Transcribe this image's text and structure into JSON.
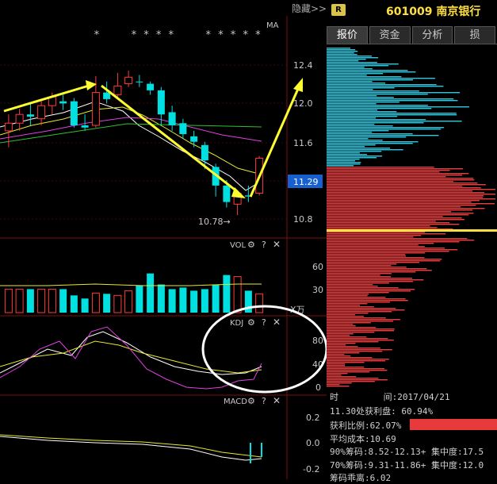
{
  "toolbar": {
    "hide_label": "隐藏>>"
  },
  "stock": {
    "badge": "R",
    "code_name": "601009 南京银行"
  },
  "tabs": [
    {
      "label": "报价"
    },
    {
      "label": "资金"
    },
    {
      "label": "分析"
    },
    {
      "label": "损"
    }
  ],
  "info": {
    "time_label": "时",
    "time_value": "间:2017/04/21",
    "profit_line": "11.30处获利盘: 60.94%",
    "profit_ratio": "获利比例:62.07%",
    "avg_cost": "平均成本:10.69",
    "chip90": "90%筹码:8.52-12.13+ 集中度:17.5",
    "chip70": "70%筹码:9.31-11.86+ 集中度:12.0",
    "chip_divergence": "筹码乖离:6.02"
  },
  "chart_data": {
    "type": "candlestick",
    "panels": [
      {
        "name": "price",
        "label_top_right": "MA",
        "stars": "*     * * * *     * * * * *",
        "y_ticks": [
          12.4,
          12.0,
          11.6,
          10.8
        ],
        "current_price": 11.29,
        "low_annotation": "10.78→",
        "ylim": [
          10.6,
          12.6
        ],
        "candles": [
          {
            "o": 11.55,
            "c": 11.62,
            "h": 11.7,
            "l": 11.4,
            "up": true
          },
          {
            "o": 11.62,
            "c": 11.7,
            "h": 11.75,
            "l": 11.55,
            "up": true
          },
          {
            "o": 11.7,
            "c": 11.68,
            "h": 11.8,
            "l": 11.6,
            "up": false
          },
          {
            "o": 11.66,
            "c": 11.78,
            "h": 11.82,
            "l": 11.6,
            "up": true
          },
          {
            "o": 11.78,
            "c": 11.86,
            "h": 11.9,
            "l": 11.7,
            "up": true
          },
          {
            "o": 11.8,
            "c": 11.82,
            "h": 11.88,
            "l": 11.74,
            "up": false
          },
          {
            "o": 11.82,
            "c": 11.6,
            "h": 11.85,
            "l": 11.58,
            "up": false
          },
          {
            "o": 11.6,
            "c": 11.58,
            "h": 11.7,
            "l": 11.55,
            "up": false
          },
          {
            "o": 11.6,
            "c": 11.9,
            "h": 12.05,
            "l": 11.58,
            "up": true
          },
          {
            "o": 11.9,
            "c": 11.84,
            "h": 12.0,
            "l": 11.8,
            "up": false
          },
          {
            "o": 11.88,
            "c": 11.96,
            "h": 12.08,
            "l": 11.85,
            "up": true
          },
          {
            "o": 11.98,
            "c": 12.04,
            "h": 12.1,
            "l": 11.95,
            "up": true
          },
          {
            "o": 12.0,
            "c": 12.0,
            "h": 12.06,
            "l": 11.95,
            "up": false
          },
          {
            "o": 11.98,
            "c": 11.92,
            "h": 12.0,
            "l": 11.88,
            "up": false
          },
          {
            "o": 11.92,
            "c": 11.7,
            "h": 11.95,
            "l": 11.6,
            "up": false
          },
          {
            "o": 11.72,
            "c": 11.6,
            "h": 11.78,
            "l": 11.55,
            "up": false
          },
          {
            "o": 11.62,
            "c": 11.52,
            "h": 11.66,
            "l": 11.48,
            "up": false
          },
          {
            "o": 11.5,
            "c": 11.45,
            "h": 11.55,
            "l": 11.4,
            "up": false
          },
          {
            "o": 11.42,
            "c": 11.28,
            "h": 11.45,
            "l": 11.2,
            "up": false
          },
          {
            "o": 11.22,
            "c": 11.05,
            "h": 11.25,
            "l": 10.95,
            "up": false
          },
          {
            "o": 11.05,
            "c": 10.9,
            "h": 11.1,
            "l": 10.85,
            "up": false
          },
          {
            "o": 10.88,
            "c": 10.98,
            "h": 11.0,
            "l": 10.78,
            "up": true
          },
          {
            "o": 10.96,
            "c": 10.95,
            "h": 11.05,
            "l": 10.9,
            "up": false
          },
          {
            "o": 10.98,
            "c": 11.3,
            "h": 11.32,
            "l": 10.96,
            "up": true
          }
        ]
      },
      {
        "name": "volume",
        "label": "VOL",
        "y_ticks": [
          60,
          30
        ],
        "unit": "X万",
        "values": [
          30,
          30,
          30,
          30,
          30,
          30,
          22,
          18,
          25,
          24,
          22,
          28,
          35,
          50,
          36,
          30,
          32,
          28,
          30,
          36,
          48,
          46,
          28,
          24
        ]
      },
      {
        "name": "kdj",
        "label": "KDJ",
        "y_ticks": [
          80,
          40,
          0
        ]
      },
      {
        "name": "macd",
        "label": "MACD",
        "y_ticks": [
          0.2,
          0.0,
          -0.2
        ]
      }
    ]
  },
  "colors": {
    "up": "#ff3b3b",
    "down": "#00e0e0",
    "arrow": "#ffff30",
    "price_box": "#1860d0"
  }
}
